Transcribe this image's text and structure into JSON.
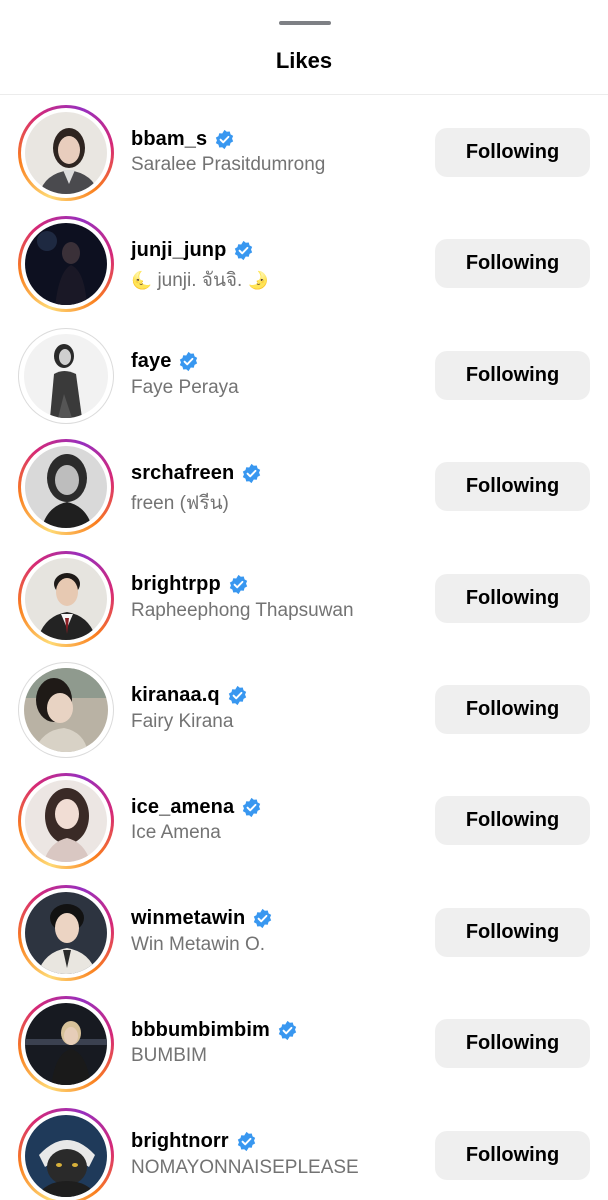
{
  "header": {
    "title": "Likes"
  },
  "colors": {
    "verified_badge": "#3897f0",
    "button_background": "#efefef",
    "secondary_text": "#737373",
    "story_ring": [
      "#feda75",
      "#fa7e1e",
      "#d62976",
      "#962fbf"
    ]
  },
  "likes": [
    {
      "username": "bbam_s",
      "full_name": "Saralee Prasitdumrong",
      "verified": true,
      "story_ring": true,
      "button": "Following"
    },
    {
      "username": "junji_junp",
      "full_name_prefix": "🌜",
      "full_name": " junji. จันจิ. ",
      "full_name_suffix": "🌛",
      "verified": true,
      "story_ring": true,
      "button": "Following"
    },
    {
      "username": "faye",
      "full_name": "Faye Peraya",
      "verified": true,
      "story_ring": false,
      "button": "Following"
    },
    {
      "username": "srchafreen",
      "full_name": "freen (ฟรีน)",
      "verified": true,
      "story_ring": true,
      "button": "Following"
    },
    {
      "username": "brightrpp",
      "full_name": "Rapheephong Thapsuwan",
      "verified": true,
      "story_ring": true,
      "button": "Following"
    },
    {
      "username": "kiranaa.q",
      "full_name": "Fairy Kirana",
      "verified": true,
      "story_ring": false,
      "button": "Following"
    },
    {
      "username": "ice_amena",
      "full_name": "Ice Amena",
      "verified": true,
      "story_ring": true,
      "button": "Following"
    },
    {
      "username": "winmetawin",
      "full_name": "Win Metawin O.",
      "verified": true,
      "story_ring": true,
      "button": "Following"
    },
    {
      "username": "bbbumbimbim",
      "full_name": "BUMBIM",
      "verified": true,
      "story_ring": true,
      "button": "Following"
    },
    {
      "username": "brightnorr",
      "full_name": "NOMAYONNAISEPLEASE",
      "verified": true,
      "story_ring": true,
      "button": "Following"
    }
  ]
}
